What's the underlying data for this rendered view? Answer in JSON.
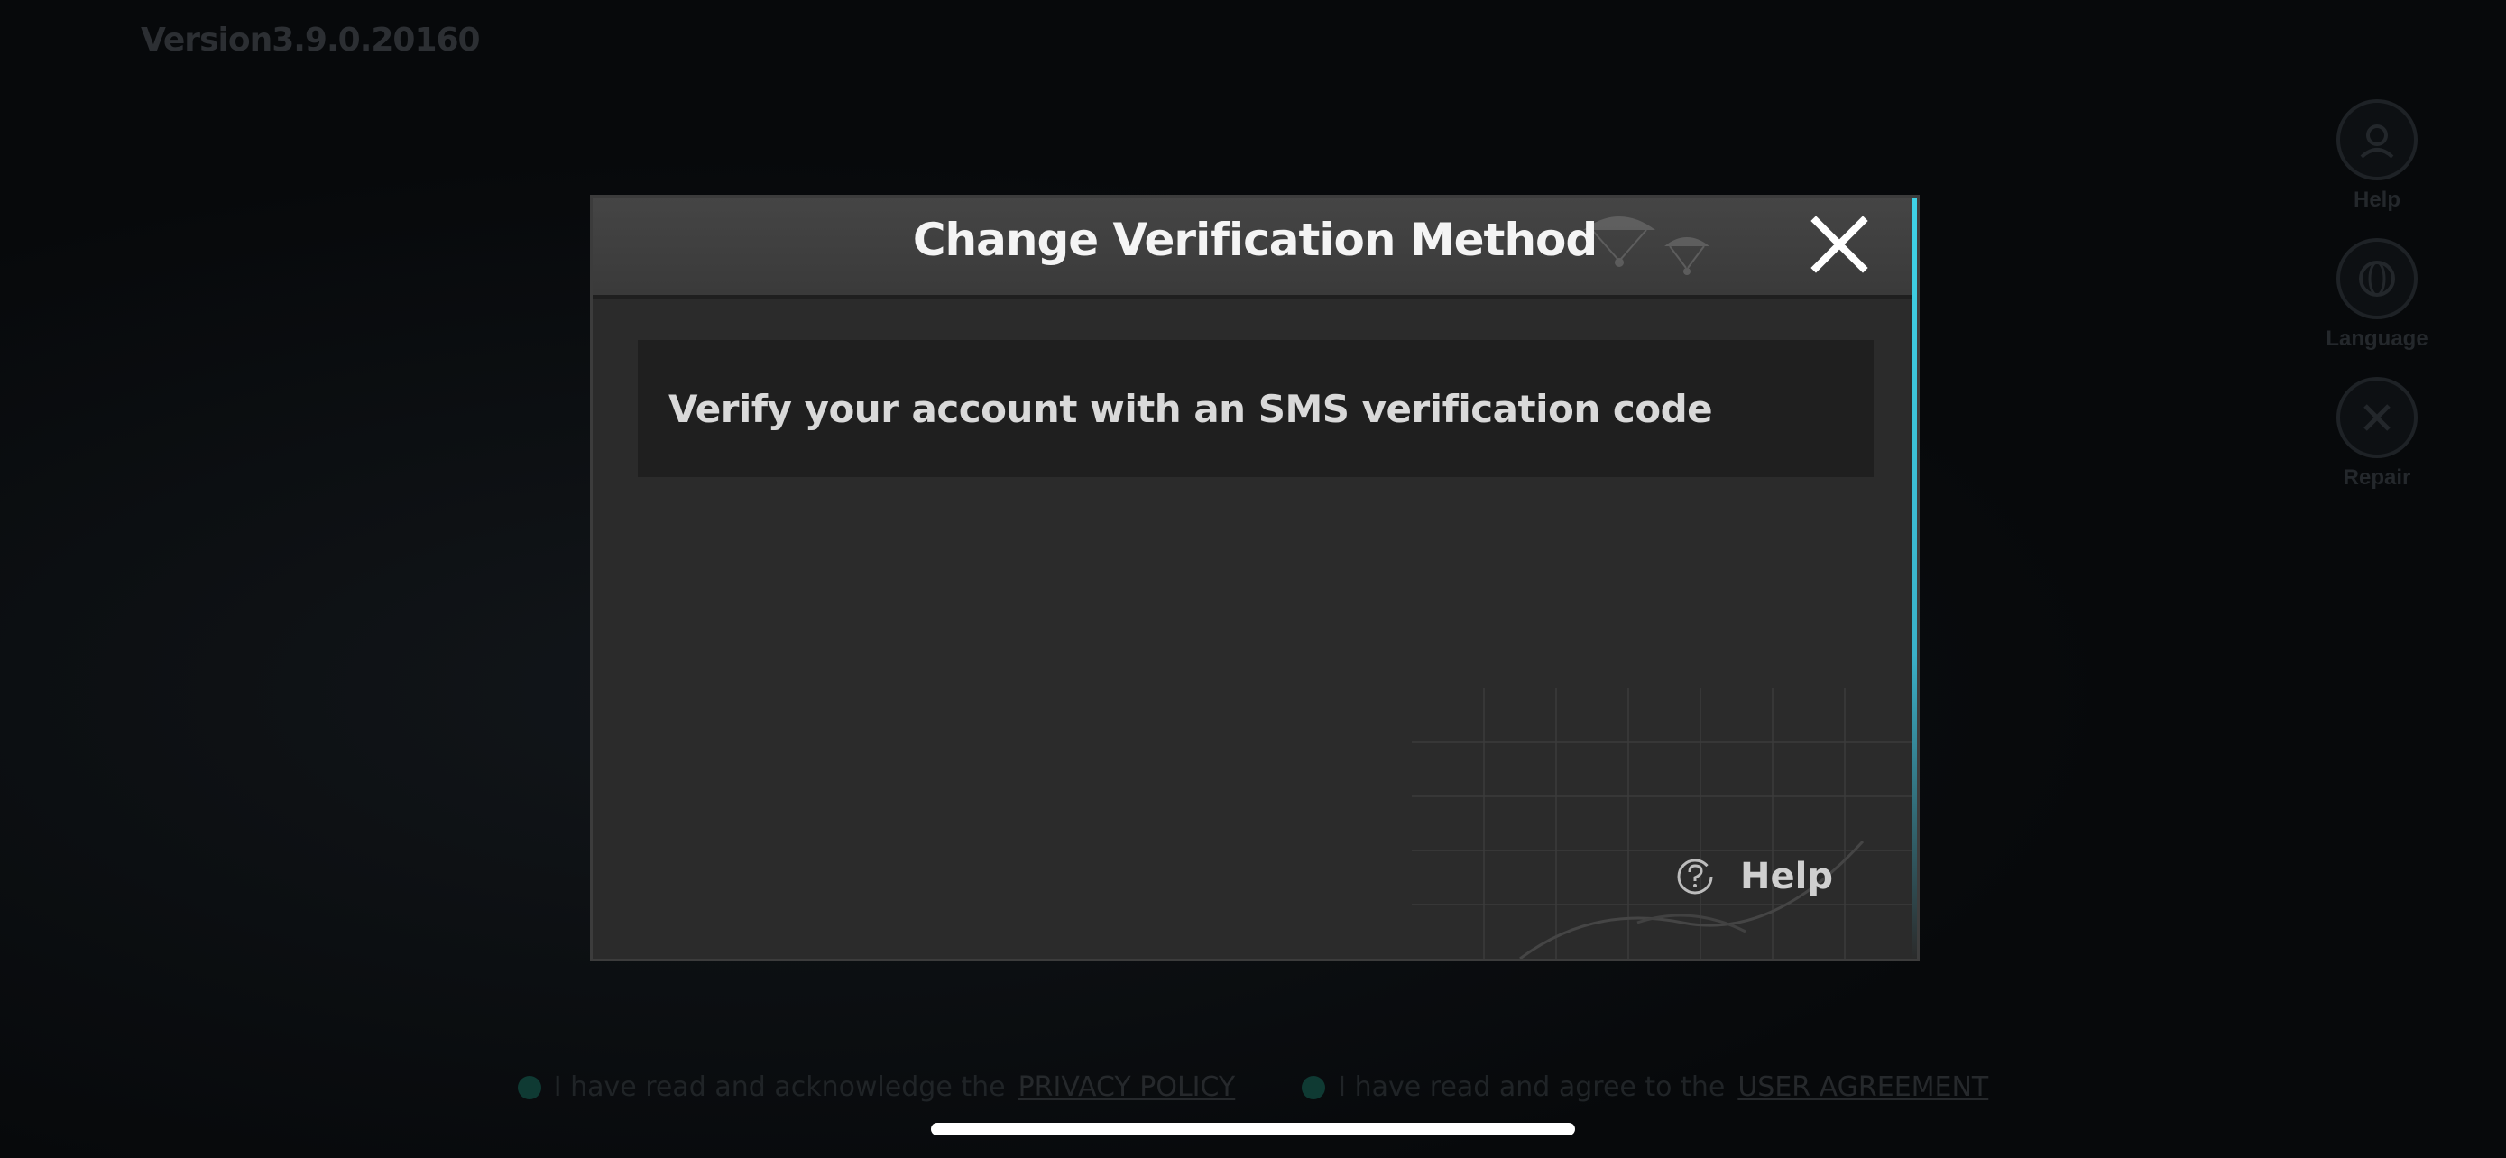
{
  "background": {
    "version": "Version3.9.0.20160",
    "side_menu": [
      {
        "label": "Help",
        "icon": "support-agent-icon"
      },
      {
        "label": "Language",
        "icon": "globe-icon"
      },
      {
        "label": "Repair",
        "icon": "tools-icon"
      }
    ],
    "footer": {
      "privacy_text": "I have read and acknowledge the",
      "privacy_link": "PRIVACY POLICY",
      "agreement_text": "I have read and agree to the",
      "agreement_link": "USER AGREEMENT"
    }
  },
  "dialog": {
    "title": "Change Verification Method",
    "close_icon": "close-icon",
    "options": [
      {
        "label": "Verify your account with an SMS verification code"
      }
    ],
    "help": {
      "label": "Help",
      "icon": "help-circle-icon"
    }
  },
  "colors": {
    "accent_cyan": "#3fd2e6",
    "dialog_bg": "#2b2b2b",
    "header_bg": "#424242",
    "option_bg": "#1f1f1f"
  }
}
